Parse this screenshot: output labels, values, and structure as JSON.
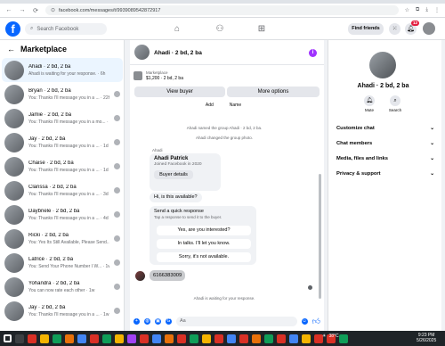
{
  "browser": {
    "url": "facebook.com/messages/t/9939089542872917",
    "nav_icons": [
      "back-icon",
      "forward-icon",
      "reload-icon",
      "home-icon"
    ]
  },
  "fb_header": {
    "logo": "f",
    "search_placeholder": "Search Facebook",
    "find_friends": "Find friends",
    "notification_count": "12"
  },
  "sidebar": {
    "title": "Marketplace",
    "conversations": [
      {
        "title": "Ahadi · 2 bd, 2 ba",
        "sub": "Ahadi is waiting for your response. · 6h",
        "active": true
      },
      {
        "title": "Bryan · 2 bd, 2 ba",
        "sub": "You: Thanks I'll message you in a ... · 22h"
      },
      {
        "title": "Jamie · 2 bd, 2 ba",
        "sub": "You: Thanks I'll message you in a mo... · 1d"
      },
      {
        "title": "Jay · 2 bd, 2 ba",
        "sub": "You: Thanks I'll message you in a ... · 1d"
      },
      {
        "title": "Chaise · 2 bd, 2 ba",
        "sub": "You: Thanks I'll message you in a ... · 1d"
      },
      {
        "title": "Clarissa · 2 bd, 2 ba",
        "sub": "You: Thanks I'll message you in a ... · 3d"
      },
      {
        "title": "Daybriele · 2 bd, 2 ba",
        "sub": "You: Thanks I'll message you in a ... · 4d"
      },
      {
        "title": "Ricki · 2 bd, 2 ba",
        "sub": "You: Yes Its Still Available, Please Send... · 1w"
      },
      {
        "title": "Latrice · 2 bd, 2 ba",
        "sub": "You: Send Your Phone Number I W... · 1w"
      },
      {
        "title": "Yohandra · 2 bd, 2 ba",
        "sub": "You can now rate each other · 1w"
      },
      {
        "title": "Jay · 2 bd, 2 ba",
        "sub": "You: Thanks I'll message you in a ... · 1w"
      }
    ]
  },
  "chat": {
    "name": "Ahadi · 2 bd, 2 ba",
    "listing_category": "Marketplace",
    "listing_desc": "$1,200 · 2 bd, 2 ba",
    "view_buyer": "View buyer",
    "more_options": "More options",
    "shortcut_add": "Add",
    "shortcut_name": "Name",
    "sys_named": "Ahadi named the group Ahadi · 2 bd, 2 ba.",
    "sys_photo": "Ahadi changed the group photo.",
    "sender_label": "Ahadi",
    "intro_name": "Ahadi Patrick",
    "intro_joined": "Joined Facebook in 2020",
    "buyer_details": "Buyer details",
    "msg_available": "Hi, is this available?",
    "quick_title": "Send a quick response",
    "quick_sub": "Tap a response to send it to the buyer.",
    "quick_options": [
      "Yes, are you interested?",
      "In talks. I'll let you know.",
      "Sorry, it's not available."
    ],
    "phone_msg": "6166383009",
    "waiting": "Ahadi is waiting for your response.",
    "composer_placeholder": "Aa"
  },
  "right_panel": {
    "name": "Ahadi · 2 bd, 2 ba",
    "mute": "Mute",
    "search": "Search",
    "sections": [
      "Customize chat",
      "Chat members",
      "Media, files and links",
      "Privacy & support"
    ]
  },
  "taskbar": {
    "weather": "38°C",
    "time": "9:23 PM",
    "date": "5/26/2025"
  }
}
